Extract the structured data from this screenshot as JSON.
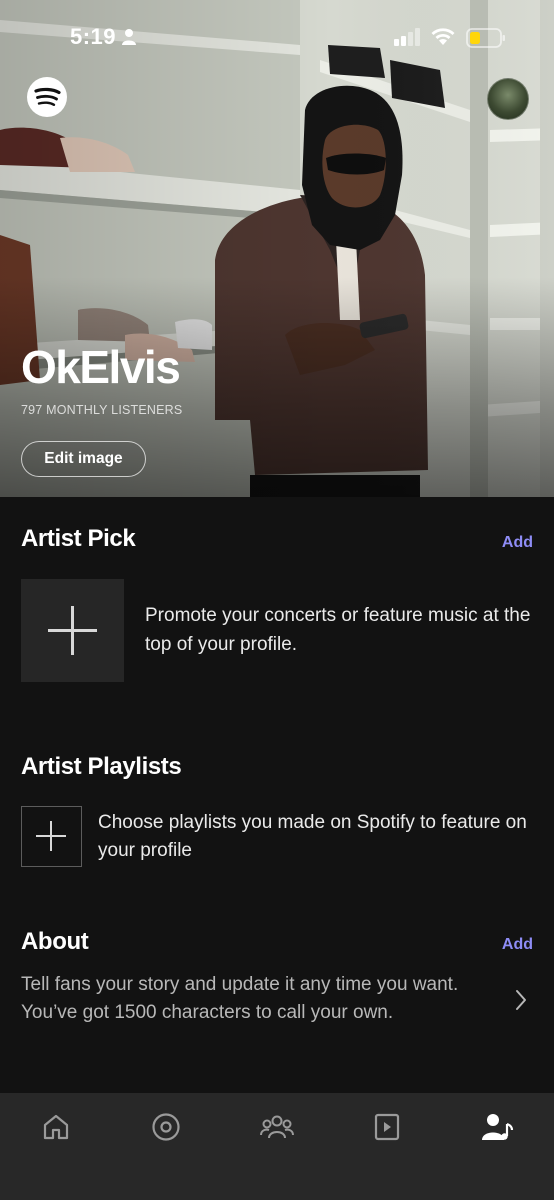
{
  "status_bar": {
    "time": "5:19"
  },
  "profile": {
    "artist_name": "OkElvis",
    "monthly_listeners": "797 MONTHLY LISTENERS",
    "edit_image_label": "Edit image"
  },
  "artist_pick": {
    "title": "Artist Pick",
    "add_label": "Add",
    "description": "Promote your concerts or feature music at the top of your profile."
  },
  "artist_playlists": {
    "title": "Artist Playlists",
    "description": "Choose playlists you made on Spotify to feature on your profile"
  },
  "about": {
    "title": "About",
    "add_label": "Add",
    "description": "Tell fans your story and update it any time you want. You’ve got 1500 characters to call your own."
  },
  "bottom_nav": {
    "items": [
      {
        "icon": "home-icon",
        "active": false
      },
      {
        "icon": "music-disc-icon",
        "active": false
      },
      {
        "icon": "audience-icon",
        "active": false
      },
      {
        "icon": "video-icon",
        "active": false
      },
      {
        "icon": "profile-music-icon",
        "active": true
      }
    ]
  },
  "colors": {
    "background": "#121212",
    "accent": "#8e8cf5",
    "nav_background": "#282828"
  }
}
